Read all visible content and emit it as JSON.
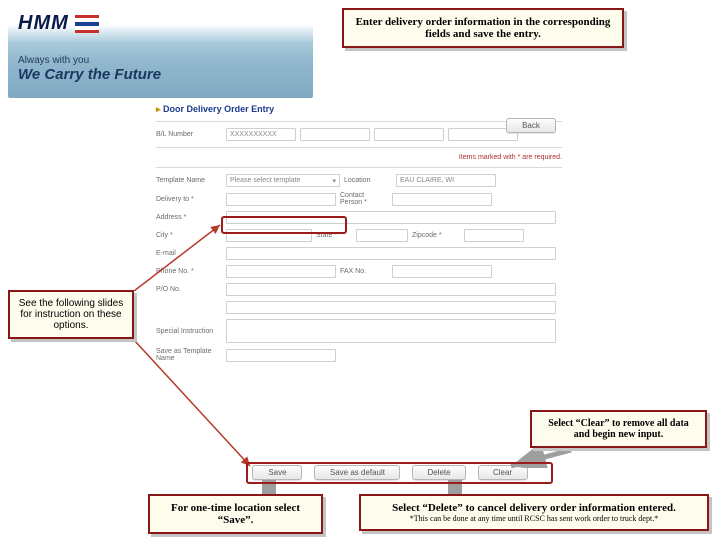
{
  "header": {
    "brand": "HMM",
    "tagline": "Always with you",
    "slogan": "We Carry the Future"
  },
  "callouts": {
    "top": "Enter delivery order information in the corresponding fields and save the entry.",
    "left": "See the following slides for instruction on these options.",
    "clear": "Select “Clear” to remove all data and begin new input.",
    "save": "For one-time location select “Save”.",
    "delete_main": "Select “Delete” to cancel delivery order information entered.",
    "delete_sub": "*This can be done at any time until RCSC has sent work order to truck dept.*"
  },
  "form": {
    "title": "Door Delivery Order Entry",
    "back_btn": "Back",
    "required_note": "Items marked with * are required.",
    "labels": {
      "bl_number": "B/L Number",
      "template_name": "Template Name",
      "location": "Location",
      "delivery_to": "Delivery to *",
      "contact_person": "Contact Person *",
      "address": "Address *",
      "city": "City *",
      "state": "State *",
      "zipcode": "Zipcode *",
      "email": "E-mail",
      "phone": "Phone No. *",
      "fax": "FAX No.",
      "po": "P/O No.",
      "special_instruction": "Special Instruction",
      "save_template": "Save as Template Name"
    },
    "values": {
      "bl_number": "XXXXXXXXXX",
      "template_placeholder": "Please select template",
      "location_value": "EAU CLAIRE, WI"
    },
    "buttons": {
      "save": "Save",
      "save_default": "Save as default",
      "delete": "Delete",
      "clear": "Clear"
    }
  }
}
